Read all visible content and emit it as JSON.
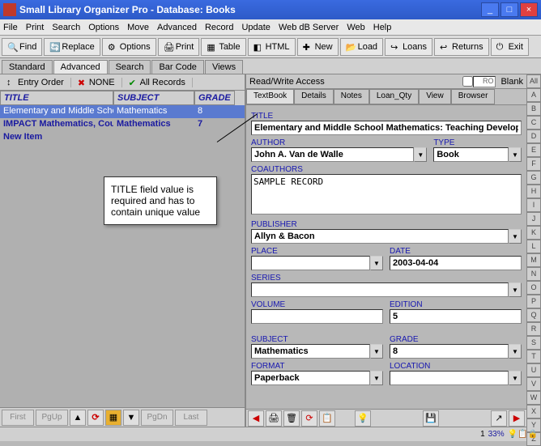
{
  "window": {
    "title": "Small Library Organizer Pro - Database: Books"
  },
  "menu": [
    "File",
    "Print",
    "Search",
    "Options",
    "Move",
    "Advanced",
    "Record",
    "Update",
    "Web dB Server",
    "Web",
    "Help"
  ],
  "toolbar": [
    {
      "label": "Find"
    },
    {
      "label": "Replace"
    },
    {
      "label": "Options"
    },
    {
      "label": "Print"
    },
    {
      "label": "Table"
    },
    {
      "label": "HTML"
    },
    {
      "label": "New"
    },
    {
      "label": "Load"
    },
    {
      "label": "Loans"
    },
    {
      "label": "Returns"
    },
    {
      "label": "Exit"
    }
  ],
  "maintabs": [
    "Standard",
    "Advanced",
    "Search",
    "Bar Code",
    "Views"
  ],
  "filters": {
    "entry": "Entry Order",
    "none": "NONE",
    "all": "All Records"
  },
  "gridhead": {
    "c1": "TITLE",
    "c2": "SUBJECT",
    "c3": "GRADE"
  },
  "rows": [
    {
      "title": "Elementary and Middle School",
      "subject": "Mathematics",
      "grade": "8"
    },
    {
      "title": "IMPACT Mathematics, Course",
      "subject": "Mathematics",
      "grade": "7"
    },
    {
      "title": "New Item",
      "subject": "",
      "grade": ""
    }
  ],
  "nav": {
    "first": "First",
    "pgup": "PgUp",
    "pgdn": "PgDn",
    "last": "Last"
  },
  "rw": {
    "label": "Read/Write Access",
    "ro": "RO",
    "blank": "Blank"
  },
  "dtabs": [
    "TextBook",
    "Details",
    "Notes",
    "Loan_Qty",
    "View",
    "Browser"
  ],
  "form": {
    "title_lbl": "TITLE",
    "title": "Elementary and Middle School Mathematics: Teaching Developmen",
    "author_lbl": "AUTHOR",
    "author": "John A. Van de Walle",
    "type_lbl": "TYPE",
    "type": "Book",
    "coauthors_lbl": "COAUTHORS",
    "coauthors": "SAMPLE RECORD",
    "publisher_lbl": "PUBLISHER",
    "publisher": "Allyn & Bacon",
    "place_lbl": "PLACE",
    "place": "",
    "date_lbl": "DATE",
    "date": "2003-04-04",
    "series_lbl": "SERIES",
    "series": "",
    "volume_lbl": "VOLUME",
    "volume": "",
    "edition_lbl": "EDITION",
    "edition": "5",
    "subject_lbl": "SUBJECT",
    "subject": "Mathematics",
    "grade_lbl": "GRADE",
    "grade": "8",
    "format_lbl": "FORMAT",
    "format": "Paperback",
    "location_lbl": "LOCATION",
    "location": ""
  },
  "side": [
    "All",
    "A",
    "B",
    "C",
    "D",
    "E",
    "F",
    "G",
    "H",
    "I",
    "J",
    "K",
    "L",
    "M",
    "N",
    "O",
    "P",
    "Q",
    "R",
    "S",
    "T",
    "U",
    "V",
    "W",
    "X",
    "Y",
    "Z"
  ],
  "callout": "TITLE field value is required and has to contain unique value",
  "status": {
    "num": "1",
    "pct": "33%"
  }
}
